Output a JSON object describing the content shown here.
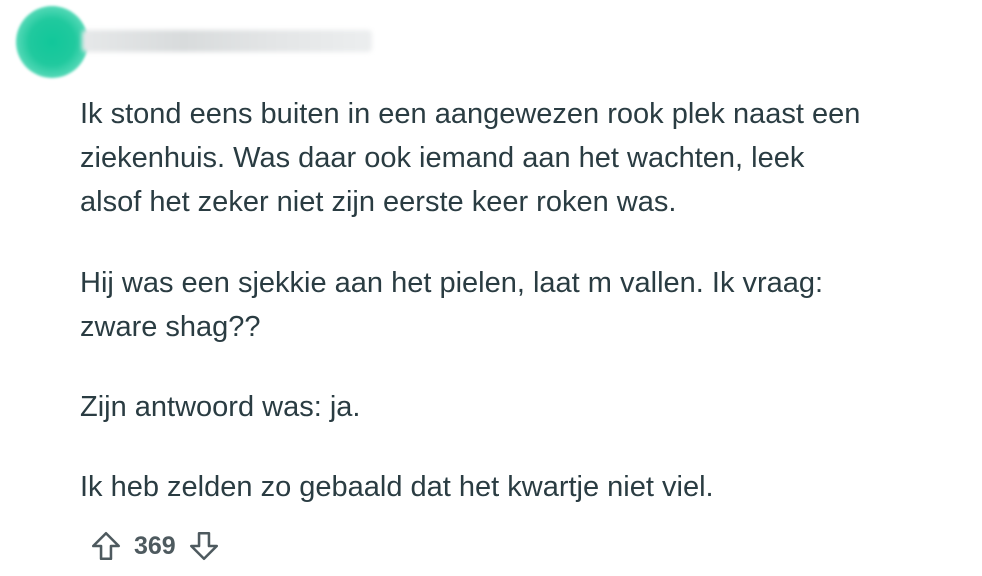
{
  "comment": {
    "paragraphs": [
      "Ik stond eens buiten in een aangewezen rook plek naast een\nziekenhuis. Was daar ook iemand aan het wachten, leek\nalsof het zeker niet zijn eerste keer roken was.",
      "Hij was een sjekkie aan het pielen, laat m vallen. Ik vraag:\nzware shag??",
      "Zijn antwoord was: ja.",
      "Ik heb zelden zo gebaald dat het kwartje niet viel."
    ],
    "score": "369"
  },
  "icons": {
    "upvote": "upvote-arrow-icon",
    "downvote": "downvote-arrow-icon"
  },
  "colors": {
    "text": "#2a3c42",
    "avatar": "#20c99e",
    "vote": "#4e5a5f"
  }
}
